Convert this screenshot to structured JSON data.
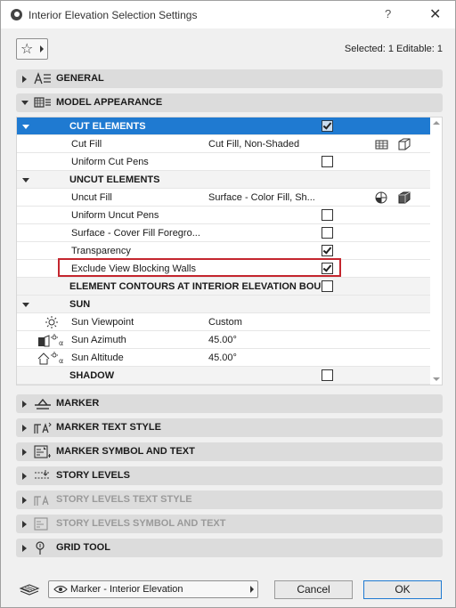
{
  "window": {
    "title": "Interior Elevation Selection Settings",
    "help": "?",
    "close": "✕"
  },
  "header": {
    "selection_status": "Selected: 1 Editable: 1"
  },
  "panels_top": [
    {
      "label": "GENERAL",
      "expanded": false,
      "enabled": true,
      "icon": "general-icon"
    },
    {
      "label": "MODEL APPEARANCE",
      "expanded": true,
      "enabled": true,
      "icon": "model-appearance-icon"
    }
  ],
  "tree": {
    "cut_elements": {
      "label": "CUT ELEMENTS",
      "checked": true
    },
    "cut_fill": {
      "label": "Cut Fill",
      "value": "Cut Fill, Non-Shaded"
    },
    "uniform_cut_pens": {
      "label": "Uniform Cut Pens",
      "checked": false
    },
    "uncut_elements": {
      "label": "UNCUT ELEMENTS"
    },
    "uncut_fill": {
      "label": "Uncut Fill",
      "value": "Surface - Color Fill, Sh..."
    },
    "uniform_uncut_pens": {
      "label": "Uniform Uncut Pens",
      "checked": false
    },
    "surface_cover_fill": {
      "label": "Surface - Cover Fill Foregro...",
      "checked": false
    },
    "transparency": {
      "label": "Transparency",
      "checked": true
    },
    "exclude_view_blocking": {
      "label": "Exclude View Blocking Walls",
      "checked": true
    },
    "element_contours": {
      "label": "ELEMENT CONTOURS AT INTERIOR ELEVATION BOU...",
      "checked": false
    },
    "sun": {
      "label": "SUN"
    },
    "sun_viewpoint": {
      "label": "Sun Viewpoint",
      "value": "Custom"
    },
    "sun_azimuth": {
      "label": "Sun Azimuth",
      "value": "45.00°"
    },
    "sun_altitude": {
      "label": "Sun Altitude",
      "value": "45.00°"
    },
    "shadow": {
      "label": "SHADOW",
      "checked": false
    }
  },
  "panels_bottom": [
    {
      "label": "MARKER",
      "enabled": true,
      "icon": "marker-icon"
    },
    {
      "label": "MARKER TEXT STYLE",
      "enabled": true,
      "icon": "marker-text-style-icon"
    },
    {
      "label": "MARKER SYMBOL AND TEXT",
      "enabled": true,
      "icon": "marker-symbol-icon"
    },
    {
      "label": "STORY LEVELS",
      "enabled": true,
      "icon": "story-levels-icon"
    },
    {
      "label": "STORY LEVELS TEXT STYLE",
      "enabled": false,
      "icon": "story-levels-text-icon"
    },
    {
      "label": "STORY LEVELS SYMBOL AND TEXT",
      "enabled": false,
      "icon": "story-levels-symbol-icon"
    },
    {
      "label": "GRID TOOL",
      "enabled": true,
      "icon": "grid-tool-icon"
    }
  ],
  "footer": {
    "layer_select": "Marker - Interior Elevation",
    "cancel": "Cancel",
    "ok": "OK"
  },
  "colors": {
    "selection": "#1f7ad1",
    "highlight_box": "#c4262e"
  }
}
